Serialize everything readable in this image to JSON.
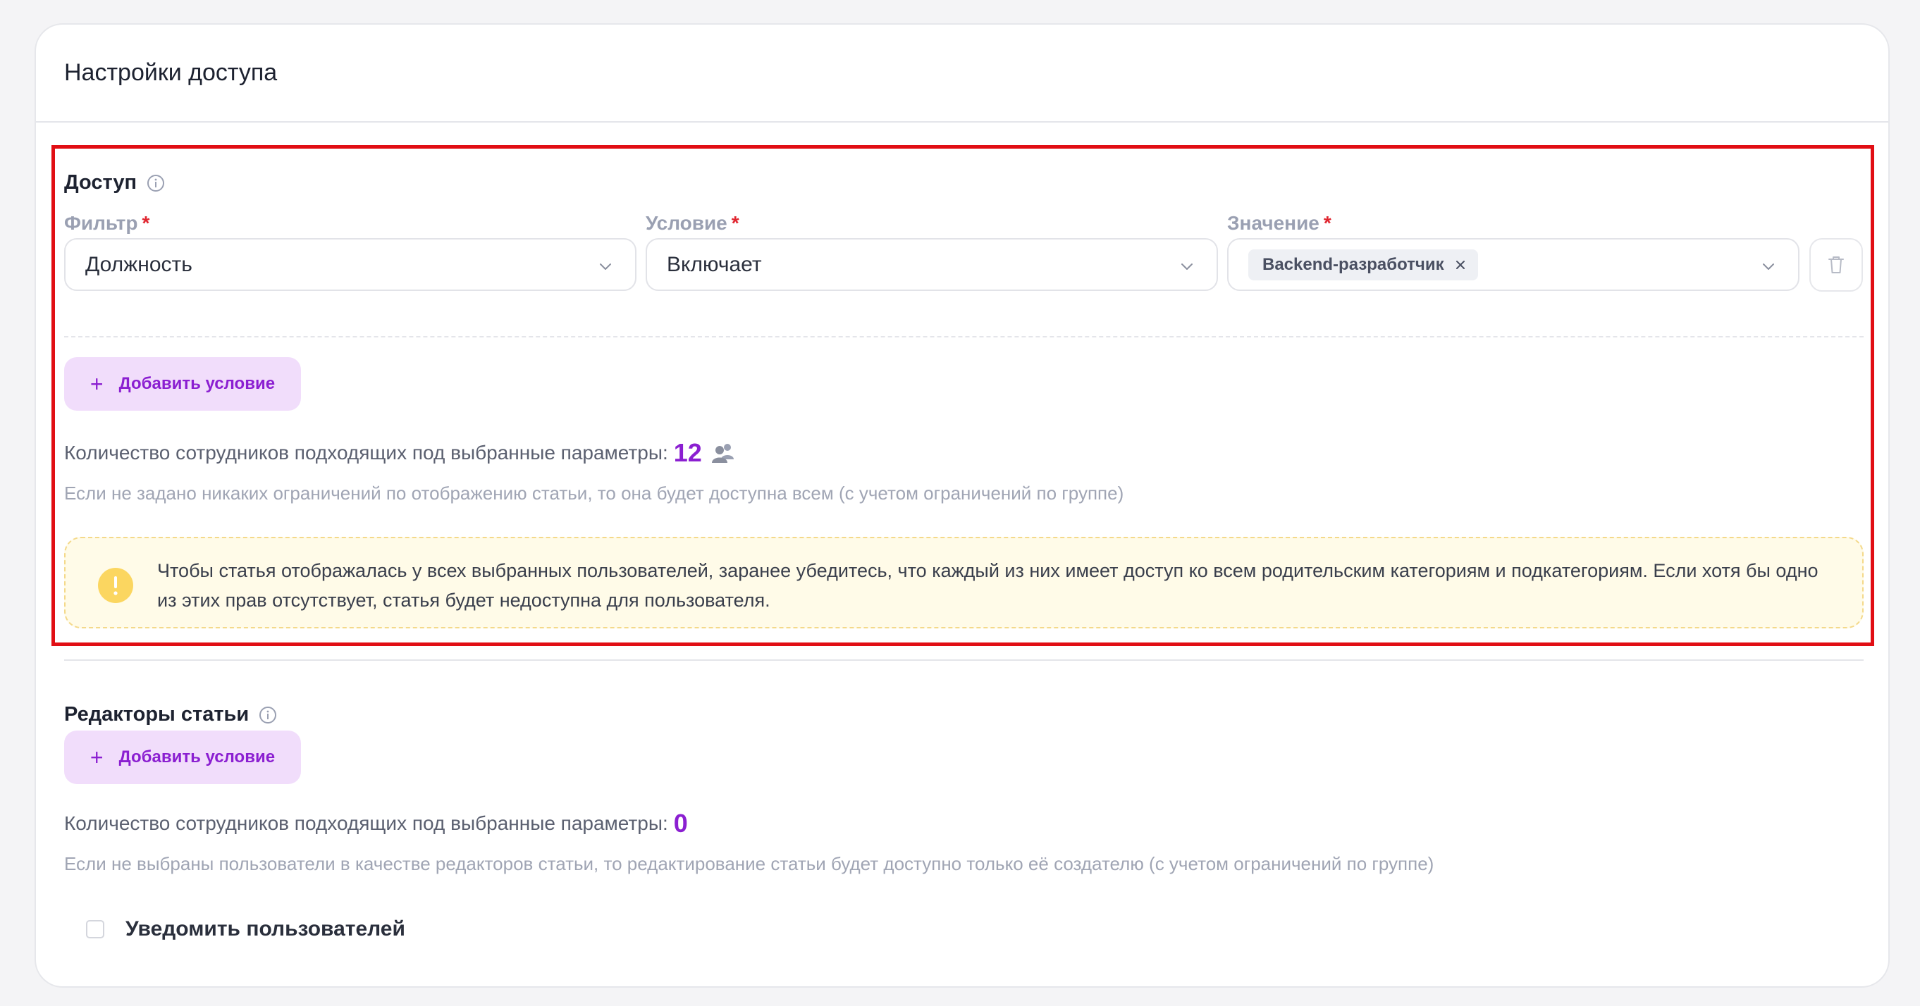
{
  "card": {
    "title": "Настройки доступа"
  },
  "access": {
    "title": "Доступ",
    "fields": {
      "filter": {
        "label": "Фильтр",
        "value": "Должность"
      },
      "condition": {
        "label": "Условие",
        "value": "Включает"
      },
      "value": {
        "label": "Значение",
        "tag": "Backend-разработчик"
      },
      "required_mark": "*"
    },
    "add_condition_label": "Добавить условие",
    "count_label": "Количество сотрудников подходящих под выбранные параметры:",
    "count_value": "12",
    "hint": "Если не задано никаких ограничений по отображению статьи, то она будет доступна всем (с учетом ограничений по группе)",
    "alert_text": "Чтобы статья отображалась у всех выбранных пользователей, заранее убедитесь, что каждый из них имеет доступ ко всем родительским категориям и подкатегориям. Если хотя бы одно из этих прав отсутствует, статья будет недоступна для пользователя."
  },
  "editors": {
    "title": "Редакторы статьи",
    "add_condition_label": "Добавить условие",
    "count_label": "Количество сотрудников подходящих под выбранные параметры:",
    "count_value": "0",
    "hint": "Если не выбраны пользователи в качестве редакторов статьи, то редактирование статьи будет доступно только её создателю (с учетом ограничений по группе)"
  },
  "notify": {
    "label": "Уведомить пользователей",
    "checked": false
  },
  "icons": {
    "info": "info-icon",
    "chevron": "chevron-down-icon",
    "trash": "trash-icon",
    "people": "people-icon",
    "warning": "warning-icon",
    "close": "close-icon",
    "plus": "plus-icon"
  },
  "colors": {
    "accent": "#8b1fd1",
    "accent_bg": "#f1ddfb",
    "required": "#e0252f",
    "highlight_border": "#e10e14",
    "alert_bg": "#fffbe8",
    "alert_border": "#f4d98a",
    "warning_icon": "#fbd660"
  }
}
